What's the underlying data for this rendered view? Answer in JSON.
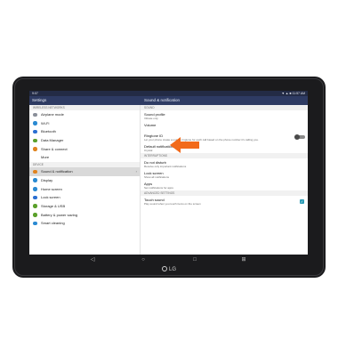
{
  "status": {
    "time": "9:07",
    "right": "▼ ▲ ■ 11:57 AM"
  },
  "appbar": {
    "left_title": "Settings",
    "right_title": "Sound & notification"
  },
  "left_sections": [
    {
      "header": "WIRELESS NETWORKS",
      "items": [
        {
          "label": "Airplane mode",
          "color": "#8a8f99"
        },
        {
          "label": "Wi-Fi",
          "color": "#2a8ad2"
        },
        {
          "label": "Bluetooth",
          "color": "#2a6fd2"
        },
        {
          "label": "Data Manager",
          "color": "#5aa02a"
        },
        {
          "label": "Share & connect",
          "color": "#e0831e"
        },
        {
          "label": "More",
          "color": "#ffffff"
        }
      ]
    },
    {
      "header": "DEVICE",
      "items": [
        {
          "label": "Sound & notification",
          "color": "#e0831e",
          "selected": true
        },
        {
          "label": "Display",
          "color": "#2a8ad2"
        },
        {
          "label": "Home screen",
          "color": "#2a8ad2"
        },
        {
          "label": "Lock screen",
          "color": "#2a6fd2"
        },
        {
          "label": "Storage & USB",
          "color": "#5aa02a"
        },
        {
          "label": "Battery & power saving",
          "color": "#5aa02a"
        },
        {
          "label": "Smart cleaning",
          "color": "#2a8ad2"
        }
      ]
    }
  ],
  "right_sections": [
    {
      "header": "SOUND",
      "items": [
        {
          "title": "Sound profile",
          "sub": "Vibrate only"
        },
        {
          "title": "Volume",
          "sub": ""
        },
        {
          "title": "Ringtone ID",
          "sub": "Let your phone create a unique ringtone for each call based on the phone number it's calling you.",
          "toggle": true
        },
        {
          "title": "Default notification sound",
          "sub": "Crystal"
        }
      ]
    },
    {
      "header": "INTERRUPTIONS",
      "items": [
        {
          "title": "Do not disturb",
          "sub": "Receive only important notifications"
        },
        {
          "title": "Lock screen",
          "sub": "Show all notifications"
        },
        {
          "title": "Apps",
          "sub": "Set notifications for apps"
        }
      ]
    },
    {
      "header": "ADVANCED SETTINGS",
      "items": [
        {
          "title": "Touch sound",
          "sub": "Play sound when you touch items on the screen",
          "check": true
        }
      ]
    }
  ],
  "navbar": {
    "back": "◁",
    "home": "○",
    "recents": "□",
    "extra": "⊞"
  },
  "logo": {
    "text": "LG"
  },
  "accent": "#f26a1a"
}
